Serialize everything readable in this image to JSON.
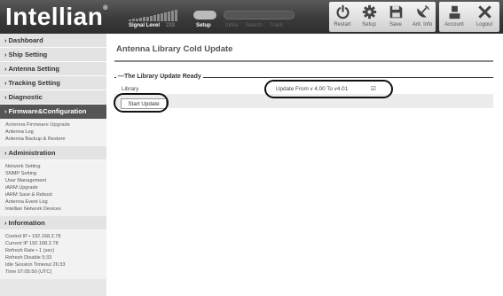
{
  "header": {
    "logo": "Intellian",
    "trademark": "®",
    "signal_label": "Signal Level",
    "signal_value": "233",
    "mode_label": "Setup",
    "status_words": [
      "Initial",
      "Search",
      "Track"
    ],
    "toolbar": [
      {
        "label": "Restart",
        "icon": "power-icon"
      },
      {
        "label": "Setup",
        "icon": "gear-icon"
      },
      {
        "label": "Save",
        "icon": "floppy-icon"
      },
      {
        "label": "Ant. Info",
        "icon": "satellite-dish-icon"
      },
      {
        "label": "Account",
        "icon": "user-icon"
      },
      {
        "label": "Logout",
        "icon": "close-icon"
      }
    ]
  },
  "sidebar": {
    "sections": [
      {
        "label": "Dashboard"
      },
      {
        "label": "Ship Setting"
      },
      {
        "label": "Antenna Setting"
      },
      {
        "label": "Tracking Setting"
      },
      {
        "label": "Diagnostic"
      },
      {
        "label": "Firmware&Configuration",
        "active": true
      }
    ],
    "firmware_items": [
      "Antenna Firmware Upgrade",
      "Antenna Log",
      "Antenna Backup & Restore"
    ],
    "admin_label": "Administration",
    "admin_items": [
      "Network Setting",
      "SNMP Setting",
      "User Management",
      "iARM Upgrade",
      "iARM Save & Reboot",
      "Antenna Event Log",
      "Intellian Network Devices"
    ],
    "info_label": "Information",
    "info_items": [
      "Control IP  •  192.168.2.78",
      "Current IP  192.168.2.78",
      "Refresh Rate •    1 (sec)",
      "Refresh Disable   5:33",
      "Idle Session Timeout  26:33",
      "Time  07:05:50 (UTC)"
    ]
  },
  "main": {
    "page_title": "Antenna Library Cold Update",
    "section_title": "The Library Update Ready",
    "library_label": "Library",
    "update_text": "Update From v 4.00 To v4.01",
    "checkbox_checked": true,
    "start_button": "Start Update"
  }
}
